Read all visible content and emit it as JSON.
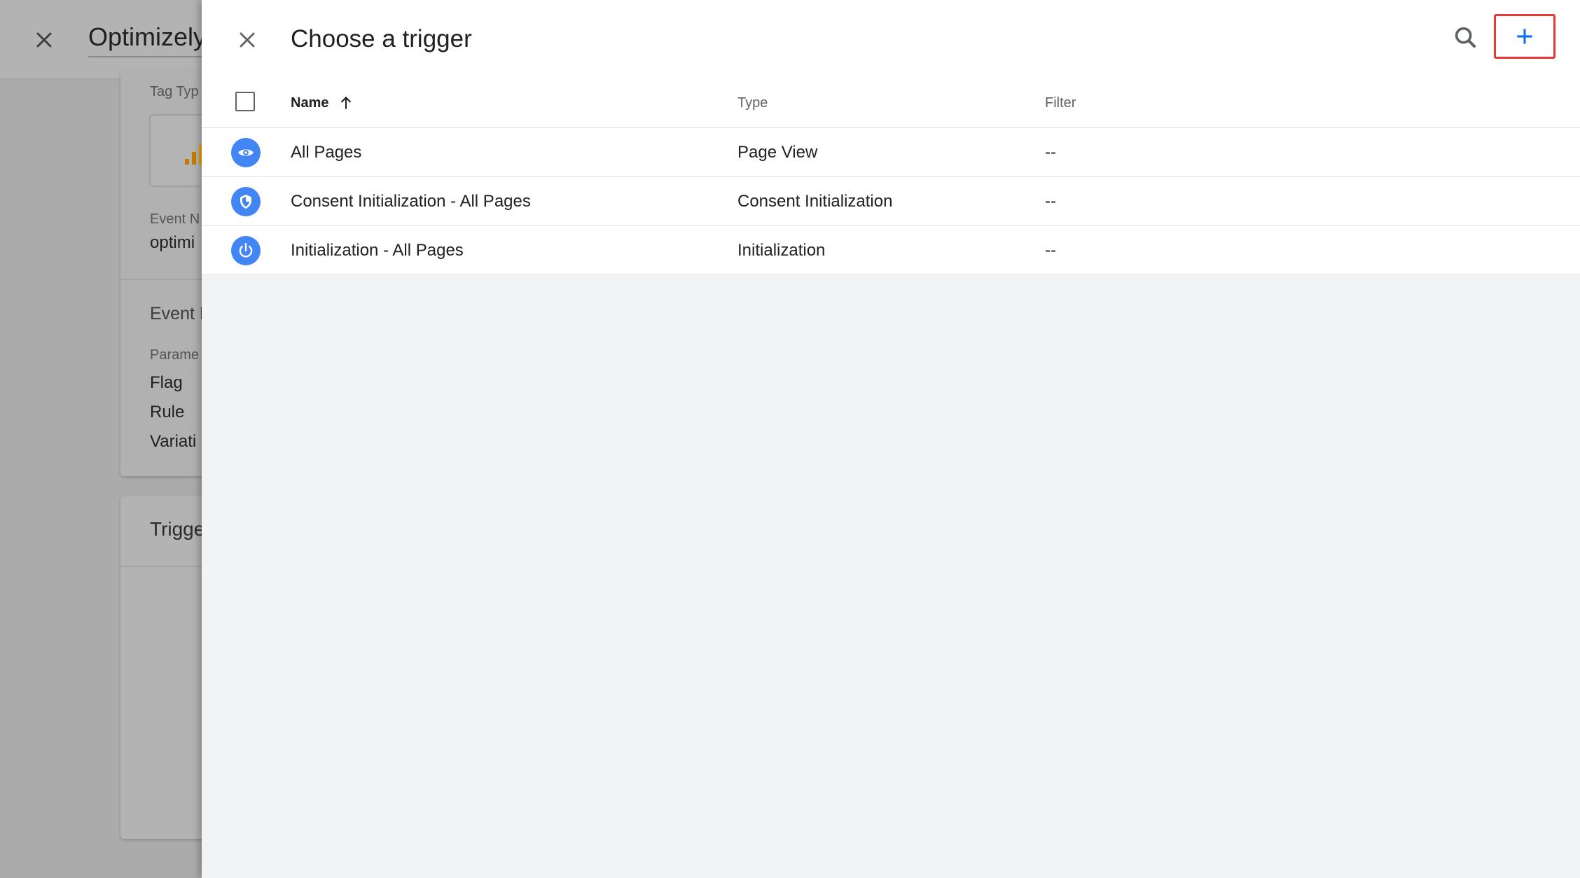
{
  "background": {
    "title": "Optimizely",
    "tag_type_label": "Tag Typ",
    "event_name_label": "Event N",
    "event_name_value": "optimi",
    "event_params_heading": "Event P",
    "parameter_label": "Parame",
    "params": [
      "Flag",
      "Rule",
      "Variati"
    ],
    "triggering_heading": "Trigge"
  },
  "panel": {
    "title": "Choose a trigger",
    "columns": {
      "name": "Name",
      "type": "Type",
      "filter": "Filter"
    },
    "rows": [
      {
        "name": "All Pages",
        "type": "Page View",
        "filter": "--",
        "icon": "eye-icon"
      },
      {
        "name": "Consent Initialization - All Pages",
        "type": "Consent Initialization",
        "filter": "--",
        "icon": "shield-icon"
      },
      {
        "name": "Initialization - All Pages",
        "type": "Initialization",
        "filter": "--",
        "icon": "power-icon"
      }
    ]
  },
  "colors": {
    "accent": "#4285f4",
    "highlight": "#e53935"
  }
}
